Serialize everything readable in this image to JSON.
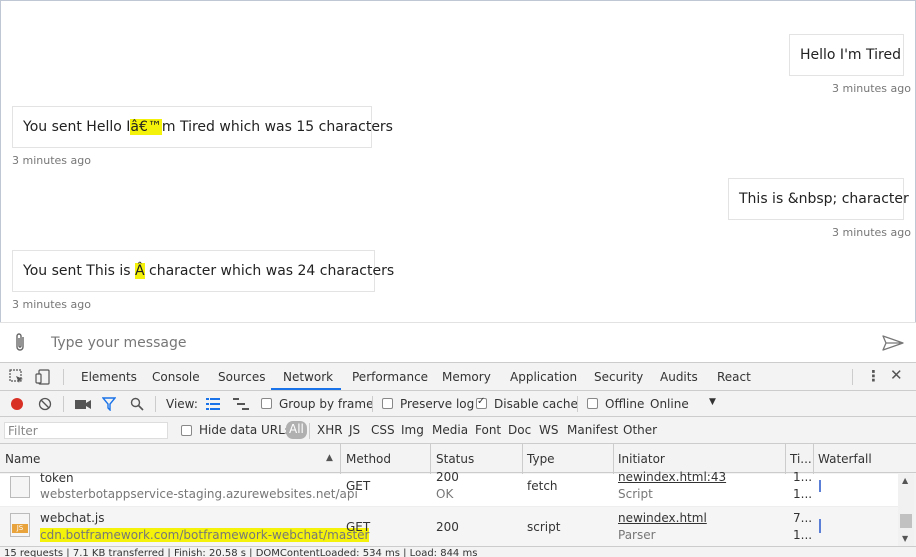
{
  "chat": {
    "messages": [
      {
        "from": "user",
        "text": "Hello I'm Tired",
        "time": "3 minutes ago"
      },
      {
        "from": "bot",
        "prefix": "You sent Hello I",
        "highlight": "â€™",
        "suffix": "m Tired which was 15 characters",
        "time": "3 minutes ago"
      },
      {
        "from": "user",
        "text": "This is &nbsp; character",
        "time": "3 minutes ago"
      },
      {
        "from": "bot",
        "prefix": "You sent This is ",
        "highlight": "Â",
        "suffix": " character which was 24 characters",
        "time": "3 minutes ago"
      }
    ],
    "composer_placeholder": "Type your message"
  },
  "devtools": {
    "tabs": [
      "Elements",
      "Console",
      "Sources",
      "Network",
      "Performance",
      "Memory",
      "Application",
      "Security",
      "Audits",
      "React"
    ],
    "active_tab": "Network",
    "toolbar": {
      "view_label": "View:",
      "group_by_frame": "Group by frame",
      "preserve_log": "Preserve log",
      "disable_cache": "Disable cache",
      "offline": "Offline",
      "throttle": "Online"
    },
    "filter": {
      "placeholder": "Filter",
      "hide_data_urls": "Hide data URLs",
      "types": [
        "All",
        "XHR",
        "JS",
        "CSS",
        "Img",
        "Media",
        "Font",
        "Doc",
        "WS",
        "Manifest",
        "Other"
      ]
    },
    "columns": [
      "Name",
      "Method",
      "Status",
      "Type",
      "Initiator",
      "Ti...",
      "Waterfall"
    ],
    "rows": [
      {
        "name": "token",
        "host": "websterbotappservice-staging.azurewebsites.net/api",
        "method": "GET",
        "status": "200",
        "status_text": "OK",
        "type": "fetch",
        "initiator": "newindex.html:43",
        "initiator_type": "Script",
        "time": "1...",
        "time2": "1..."
      },
      {
        "name": "webchat.js",
        "host": "cdn.botframework.com/botframework-webchat/master",
        "method": "GET",
        "status": "200",
        "status_text": "",
        "type": "script",
        "initiator": "newindex.html",
        "initiator_type": "Parser",
        "time": "7...",
        "time2": "1..."
      }
    ],
    "status_bar": "15 requests | 7.1 KB transferred | Finish: 20.58 s | DOMContentLoaded: 534 ms | Load: 844 ms"
  }
}
